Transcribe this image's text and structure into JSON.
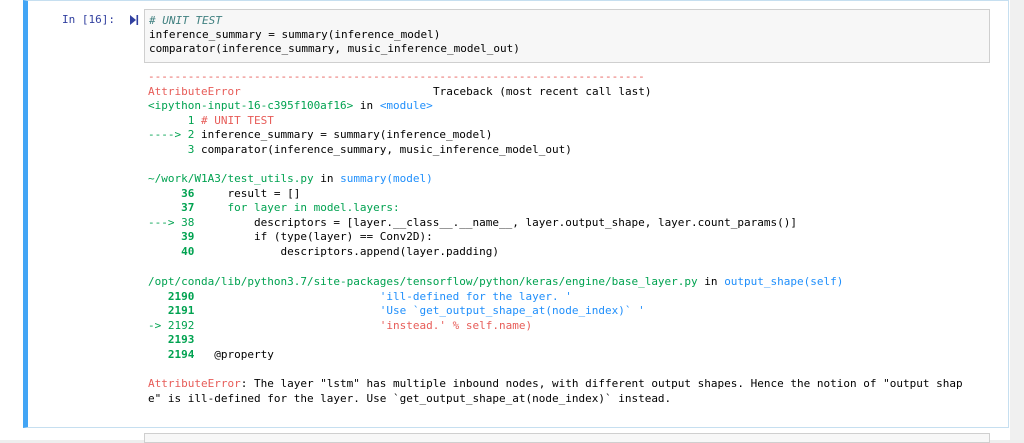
{
  "cell": {
    "prompt": "In [16]:",
    "code": [
      "# UNIT TEST",
      "inference_summary = summary(inference_model)",
      "comparator(inference_summary, music_inference_model_out)"
    ]
  },
  "traceback": {
    "rule": "---------------------------------------------------------------------------",
    "error_name": "AttributeError",
    "header": "Traceback (most recent call last)",
    "frame1": {
      "file": "<ipython-input-16-c395f100af16>",
      "in": " in ",
      "func": "<module>",
      "l1_num": "      1 ",
      "l1_text": "# UNIT TEST",
      "l2_num": "----> 2 ",
      "l2_text": "inference_summary = summary(inference_model)",
      "l3_num": "      3 ",
      "l3_text": "comparator(inference_summary, music_inference_model_out)"
    },
    "frame2": {
      "file": "~/work/W1A3/test_utils.py",
      "in": " in ",
      "func": "summary(model)",
      "l1_num": "     36 ",
      "l1_text": "    result = []",
      "l2_num": "     37 ",
      "l2_text": "    for layer in model.layers:",
      "l3_num": "---> 38 ",
      "l3_text": "        descriptors = [layer.__class__.__name__, layer.output_shape, layer.count_params()]",
      "l4_num": "     39 ",
      "l4_text": "        if (type(layer) == Conv2D):",
      "l5_num": "     40 ",
      "l5_text": "            descriptors.append(layer.padding)"
    },
    "frame3": {
      "file": "/opt/conda/lib/python3.7/site-packages/tensorflow/python/keras/engine/base_layer.py",
      "in": " in ",
      "func": "output_shape(self)",
      "l1_num": "   2190 ",
      "l1_text": "                           'ill-defined for the layer. '",
      "l2_num": "   2191 ",
      "l2_text": "                           'Use `get_output_shape_at(node_index)` '",
      "l3_num": "-> 2192 ",
      "l3_text": "                           'instead.' % self.name)",
      "l4_num": "   2193 ",
      "l4_text": "",
      "l5_num": "   2194 ",
      "l5_text": "  @property"
    },
    "final_name": "AttributeError",
    "final_msg1": ": The layer \"lstm\" has multiple inbound nodes, with different output shapes. Hence the notion of \"output shap",
    "final_msg2": "e\" is ill-defined for the layer. Use `get_output_shape_at(node_index)` instead."
  }
}
